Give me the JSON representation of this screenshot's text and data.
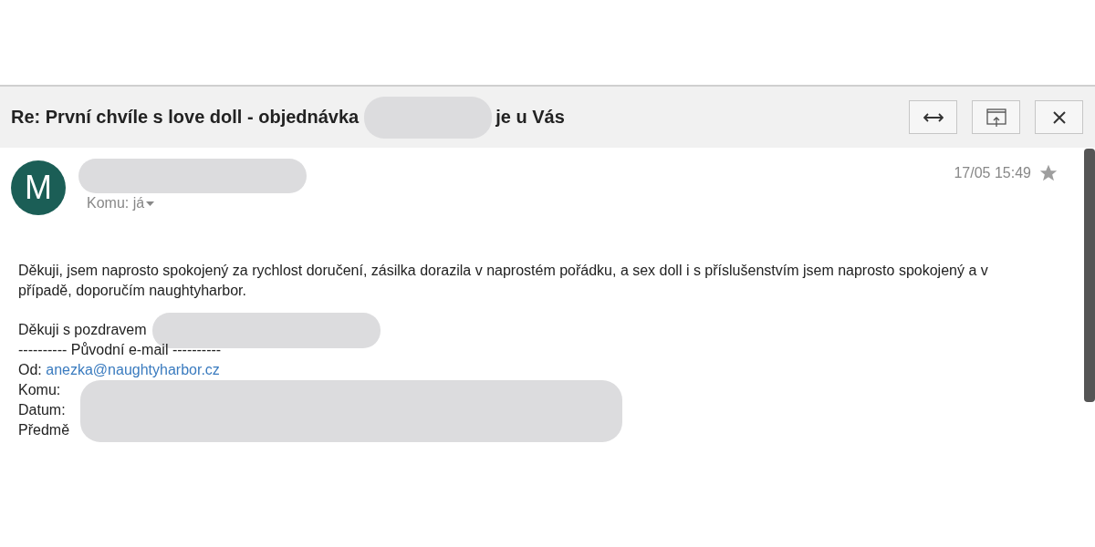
{
  "window": {
    "title_start": "Re: První chvíle s love doll - objednávka",
    "title_end": "je u Vás"
  },
  "toolbar": [
    {
      "kind": "expand"
    },
    {
      "kind": "popout"
    },
    {
      "kind": "close"
    }
  ],
  "message": {
    "avatar_letter": "M",
    "recipient_label": "Komu: já",
    "date": "17/05 15:49",
    "starred": false,
    "body": "Děkuji, jsem naprosto spokojený za rychlost doručení, zásilka dorazila v naprostém pořádku, a sex doll i s příslušenstvím jsem naprosto spokojený a v případě, doporučím naughtyharbor.",
    "greeting": "Děkuji s pozdravem",
    "forward_divider": "---------- Původní e-mail ----------",
    "from_label": "Od:",
    "from_email": "anezka@naughtyharbor.cz",
    "header_labels": [
      "Komu:",
      "Datum:",
      "Předmě"
    ]
  }
}
